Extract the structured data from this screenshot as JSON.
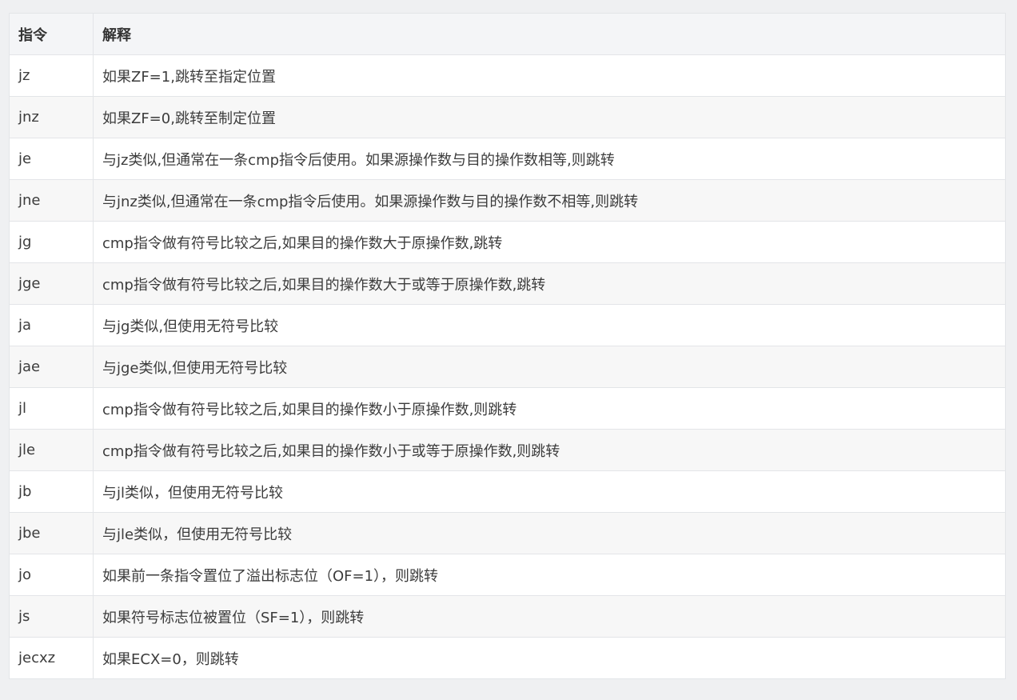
{
  "table": {
    "headers": [
      "指令",
      "解释"
    ],
    "rows": [
      {
        "cmd": "jz",
        "desc": "如果ZF=1,跳转至指定位置"
      },
      {
        "cmd": "jnz",
        "desc": "如果ZF=0,跳转至制定位置"
      },
      {
        "cmd": "je",
        "desc": "与jz类似,但通常在一条cmp指令后使用。如果源操作数与目的操作数相等,则跳转"
      },
      {
        "cmd": "jne",
        "desc": "与jnz类似,但通常在一条cmp指令后使用。如果源操作数与目的操作数不相等,则跳转"
      },
      {
        "cmd": "jg",
        "desc": "cmp指令做有符号比较之后,如果目的操作数大于原操作数,跳转"
      },
      {
        "cmd": "jge",
        "desc": "cmp指令做有符号比较之后,如果目的操作数大于或等于原操作数,跳转"
      },
      {
        "cmd": "ja",
        "desc": "与jg类似,但使用无符号比较"
      },
      {
        "cmd": "jae",
        "desc": "与jge类似,但使用无符号比较"
      },
      {
        "cmd": "jl",
        "desc": "cmp指令做有符号比较之后,如果目的操作数小于原操作数,则跳转"
      },
      {
        "cmd": "jle",
        "desc": "cmp指令做有符号比较之后,如果目的操作数小于或等于原操作数,则跳转"
      },
      {
        "cmd": "jb",
        "desc": "与jl类似，但使用无符号比较"
      },
      {
        "cmd": "jbe",
        "desc": "与jle类似，但使用无符号比较"
      },
      {
        "cmd": "jo",
        "desc": "如果前一条指令置位了溢出标志位（OF=1），则跳转"
      },
      {
        "cmd": "js",
        "desc": "如果符号标志位被置位（SF=1），则跳转"
      },
      {
        "cmd": "jecxz",
        "desc": "如果ECX=0，则跳转"
      }
    ]
  }
}
